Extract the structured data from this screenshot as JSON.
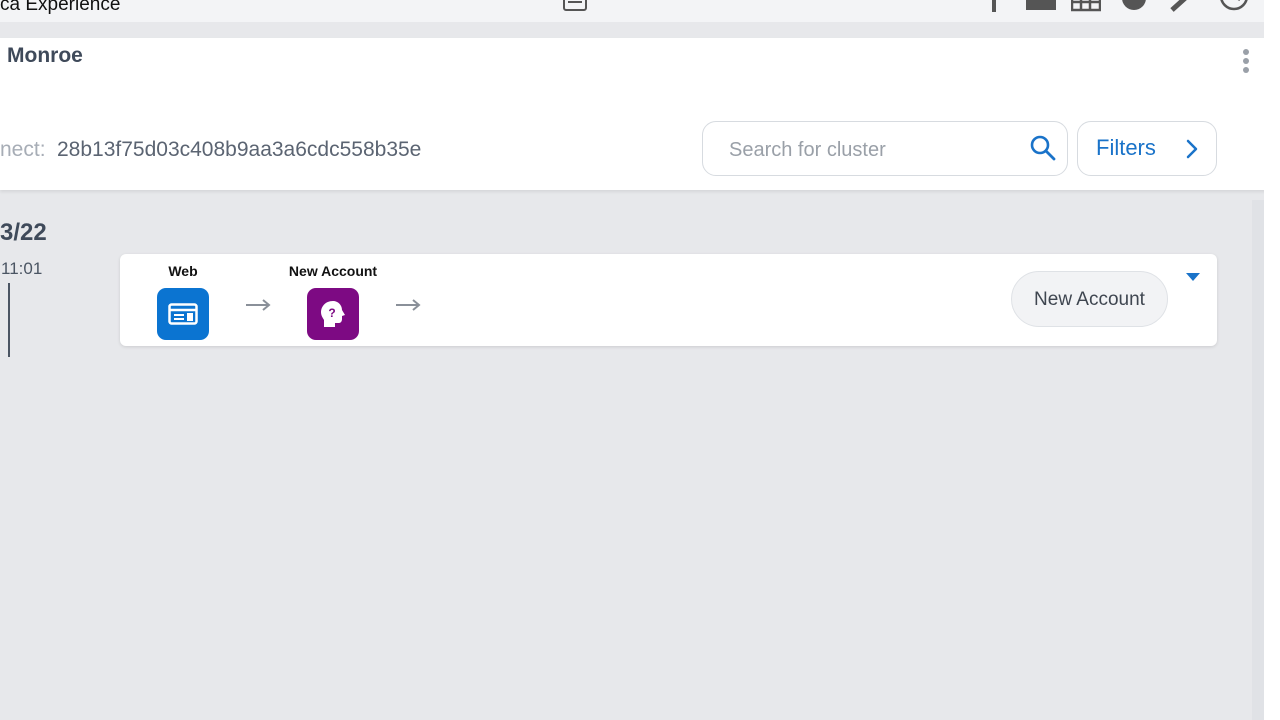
{
  "topbar": {
    "app_title": "ca Experience",
    "icons": [
      "calendar-icon",
      "person-icon",
      "image-icon",
      "grid-icon",
      "tag-icon",
      "pen-icon",
      "history-icon"
    ]
  },
  "header": {
    "person_name": "Monroe",
    "id_label": "nect:",
    "id_value": "28b13f75d03c408b9aa3a6cdc558b35e",
    "search": {
      "placeholder": "Search for cluster",
      "value": ""
    },
    "filters_label": "Filters"
  },
  "timeline": {
    "date": "3/22",
    "time": "11:01"
  },
  "journey": {
    "steps": [
      {
        "label": "Web",
        "icon": "web-form-icon",
        "color": "#0b74d1"
      },
      {
        "label": "New Account",
        "icon": "head-question-icon",
        "color": "#7d0a83"
      }
    ],
    "outcome_label": "New Account"
  },
  "colors": {
    "accent": "#1a73c9",
    "background": "#e7e8eb"
  }
}
